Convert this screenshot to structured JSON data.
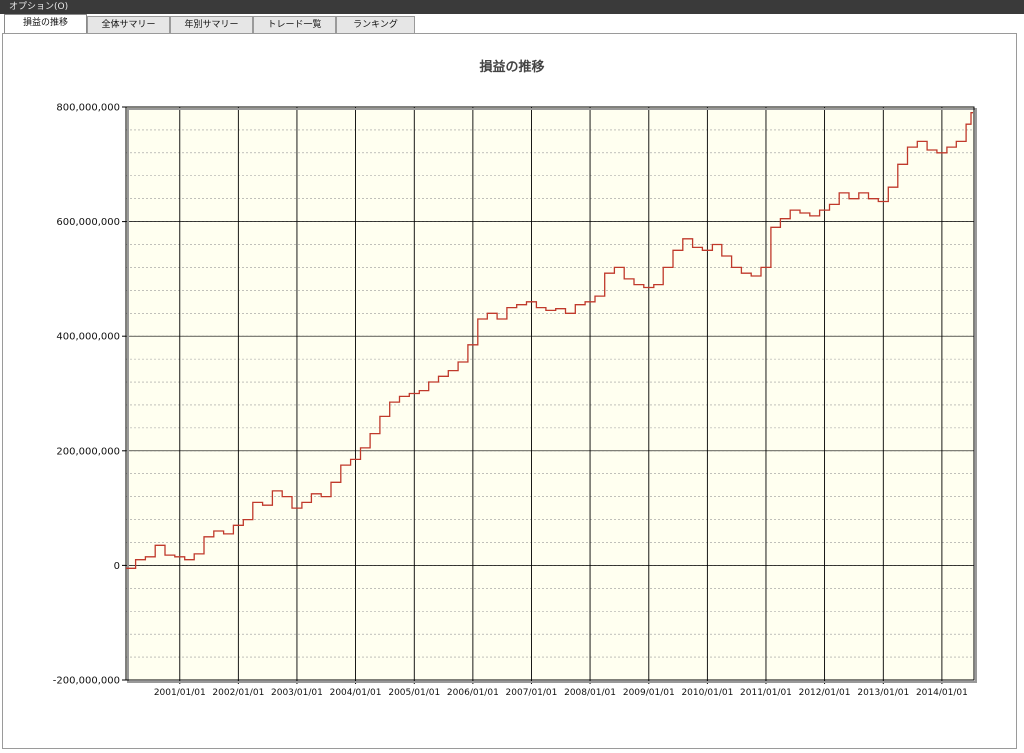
{
  "menu": {
    "options_label": "オプション(O)"
  },
  "tabs": [
    {
      "label": "損益の推移",
      "active": true
    },
    {
      "label": "全体サマリー",
      "active": false
    },
    {
      "label": "年別サマリー",
      "active": false
    },
    {
      "label": "トレード一覧",
      "active": false
    },
    {
      "label": "ランキング",
      "active": false
    }
  ],
  "colors": {
    "plot_background": "#fffff0",
    "line": "#c0392b",
    "grid_major": "#000000",
    "grid_minor": "#9a9a9a"
  },
  "chart_data": {
    "type": "line",
    "title": "損益の推移",
    "xlabel": "",
    "ylabel": "",
    "ylim": [
      -200000000,
      800000000
    ],
    "xlim": [
      "2000/02/01",
      "2014/07/20"
    ],
    "yticks": [
      {
        "value": 800000000,
        "label": "800,000,000"
      },
      {
        "value": 600000000,
        "label": "600,000,000"
      },
      {
        "value": 400000000,
        "label": "400,000,000"
      },
      {
        "value": 200000000,
        "label": "200,000,000"
      },
      {
        "value": 0,
        "label": "0"
      },
      {
        "value": -200000000,
        "label": "-200,000,000"
      }
    ],
    "xticks": [
      "2001/01/01",
      "2002/01/01",
      "2003/01/01",
      "2004/01/01",
      "2005/01/01",
      "2006/01/01",
      "2007/01/01",
      "2008/01/01",
      "2009/01/01",
      "2010/01/01",
      "2011/01/01",
      "2012/01/01",
      "2013/01/01",
      "2014/01/01"
    ],
    "grid": true,
    "step": true,
    "series": [
      {
        "x": [
          "2000/02",
          "2000/04",
          "2000/06",
          "2000/08",
          "2000/10",
          "2000/12",
          "2001/02",
          "2001/04",
          "2001/06",
          "2001/08",
          "2001/10",
          "2001/12",
          "2002/02",
          "2002/04",
          "2002/06",
          "2002/08",
          "2002/10",
          "2002/12",
          "2003/02",
          "2003/04",
          "2003/06",
          "2003/08",
          "2003/10",
          "2003/12",
          "2004/02",
          "2004/04",
          "2004/06",
          "2004/08",
          "2004/10",
          "2004/12",
          "2005/02",
          "2005/04",
          "2005/06",
          "2005/08",
          "2005/10",
          "2005/12",
          "2006/02",
          "2006/04",
          "2006/06",
          "2006/08",
          "2006/10",
          "2006/12",
          "2007/02",
          "2007/04",
          "2007/06",
          "2007/08",
          "2007/10",
          "2007/12",
          "2008/02",
          "2008/04",
          "2008/06",
          "2008/08",
          "2008/10",
          "2008/12",
          "2009/02",
          "2009/04",
          "2009/06",
          "2009/08",
          "2009/10",
          "2009/12",
          "2010/02",
          "2010/04",
          "2010/06",
          "2010/08",
          "2010/10",
          "2010/12",
          "2011/02",
          "2011/04",
          "2011/06",
          "2011/08",
          "2011/10",
          "2011/12",
          "2012/02",
          "2012/04",
          "2012/06",
          "2012/08",
          "2012/10",
          "2012/12",
          "2013/02",
          "2013/04",
          "2013/06",
          "2013/08",
          "2013/10",
          "2013/12",
          "2014/02",
          "2014/04",
          "2014/06",
          "2014/07"
        ],
        "y": [
          -5000000,
          10000000,
          15000000,
          35000000,
          18000000,
          15000000,
          10000000,
          20000000,
          50000000,
          60000000,
          55000000,
          70000000,
          80000000,
          110000000,
          105000000,
          130000000,
          120000000,
          100000000,
          110000000,
          125000000,
          120000000,
          145000000,
          175000000,
          185000000,
          205000000,
          230000000,
          260000000,
          285000000,
          295000000,
          300000000,
          305000000,
          320000000,
          330000000,
          340000000,
          355000000,
          385000000,
          430000000,
          440000000,
          430000000,
          450000000,
          455000000,
          460000000,
          450000000,
          445000000,
          448000000,
          440000000,
          455000000,
          460000000,
          470000000,
          510000000,
          520000000,
          500000000,
          490000000,
          485000000,
          490000000,
          520000000,
          550000000,
          570000000,
          555000000,
          550000000,
          560000000,
          540000000,
          520000000,
          510000000,
          505000000,
          520000000,
          590000000,
          605000000,
          620000000,
          615000000,
          610000000,
          620000000,
          630000000,
          650000000,
          640000000,
          650000000,
          640000000,
          635000000,
          660000000,
          700000000,
          730000000,
          740000000,
          725000000,
          720000000,
          730000000,
          740000000,
          770000000,
          790000000
        ]
      }
    ]
  }
}
